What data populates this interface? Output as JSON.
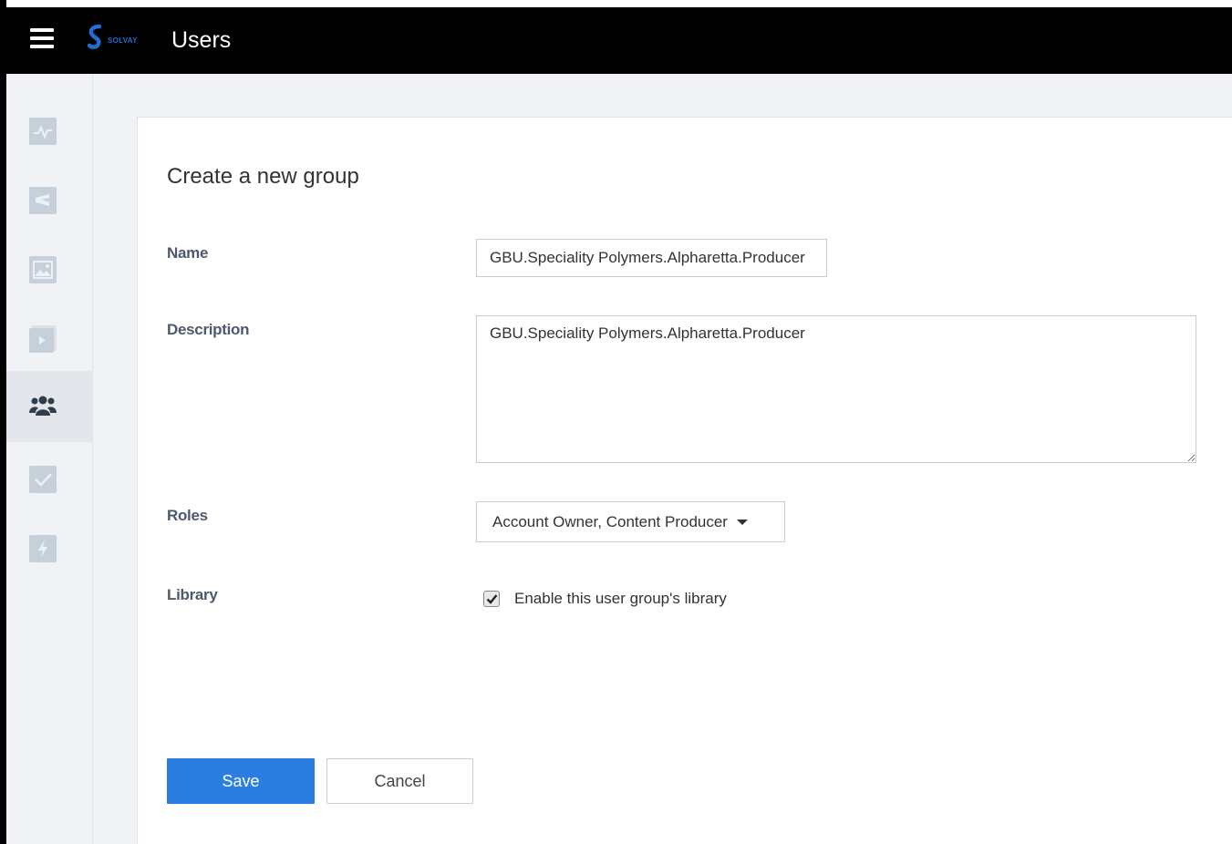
{
  "header": {
    "menu_icon": "hamburger-menu-icon",
    "logo_text": "SOLVAY",
    "title": "Users"
  },
  "sidebar": {
    "items": [
      {
        "icon": "activity-icon",
        "active": false
      },
      {
        "icon": "share-icon",
        "active": false
      },
      {
        "icon": "image-icon",
        "active": false
      },
      {
        "icon": "video-icon",
        "active": false
      },
      {
        "icon": "users-icon",
        "active": true
      },
      {
        "icon": "checkmark-icon",
        "active": false
      },
      {
        "icon": "lightning-icon",
        "active": false
      }
    ]
  },
  "form": {
    "title": "Create a new group",
    "name_label": "Name",
    "name_value": "GBU.Speciality Polymers.Alpharetta.Producer",
    "description_label": "Description",
    "description_value": "GBU.Speciality Polymers.Alpharetta.Producer",
    "roles_label": "Roles",
    "roles_value": "Account Owner, Content Producer",
    "library_label": "Library",
    "library_checkbox_label": "Enable this user group's library",
    "library_checked": true,
    "save_label": "Save",
    "cancel_label": "Cancel"
  },
  "colors": {
    "topbar": "#000000",
    "primary_button": "#2b7de0",
    "sidebar_bg": "#f0f2f5",
    "icon_gray": "#c5d0db",
    "active_icon": "#2f3d4d",
    "brand": "#1f6fd1"
  }
}
